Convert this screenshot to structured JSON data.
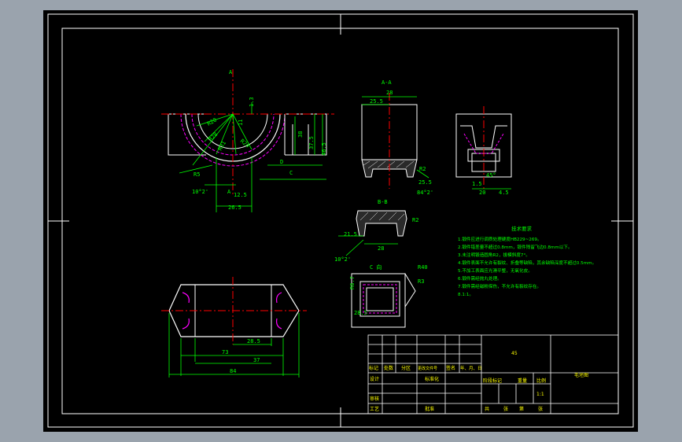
{
  "colors": {
    "window_bg": "#9aa3ad",
    "canvas_bg": "#000000",
    "outline": "#ffffff",
    "dimension": "#00ff00",
    "centerline": "#ff0000",
    "hidden": "#ff00ff",
    "note_text": "#00ff00",
    "title_text": "#ffff00",
    "cyan": "#00ffff"
  },
  "views": {
    "main": {
      "section_marker": "A",
      "dims": [
        "R5",
        "R20",
        "R28",
        "R31",
        "R24",
        "1.3",
        "11",
        "38",
        "37.5",
        "46.5",
        "D",
        "C",
        "A",
        "10°2'",
        "12.5",
        "26.5"
      ]
    },
    "section_aa": {
      "label": "A-A",
      "dims": [
        "28",
        "25.5",
        "R2",
        "25.5",
        "84°2'"
      ]
    },
    "side": {
      "dims": [
        "45°",
        "1.5",
        "20",
        "4.5"
      ]
    },
    "section_bb": {
      "label": "B-B",
      "dims": [
        "R2",
        "21.5",
        "28",
        "10°2'"
      ]
    },
    "detail_c": {
      "label": "C 向",
      "dims": [
        "R40",
        "R3",
        "R6.7",
        "28.5"
      ]
    },
    "bottom": {
      "dims": [
        "28.5",
        "73",
        "37",
        "84"
      ]
    }
  },
  "notes": {
    "title": "技术要求",
    "items": [
      "1.锻件应进行调质处理硬度HB229~269。",
      "2.锻件错差量不超过0.8mm，锻件残留飞边0.8mm以下。",
      "3.未注明锻造圆角R2，拔模斜度7°。",
      "4.锻件表面不允许有裂纹、折叠等缺陷，其余缺陷深度不超过0.5mm。",
      "5.不加工表面应光滑平整，无氧化皮。",
      "6.锻件需经抛丸处理。",
      "7.锻件需经磁粉探伤，不允许有裂纹存在。",
      "8.1:1。"
    ]
  },
  "title_block": {
    "material": "45",
    "drawing_name": "毛坯图",
    "headers": [
      "标记",
      "处数",
      "分区",
      "更改文件号",
      "签名",
      "年、月、日"
    ],
    "left_rows": [
      "设计",
      "审核",
      "工艺"
    ],
    "mid_labels": [
      "标准化",
      "批准"
    ],
    "stage_headers": [
      "阶段标记",
      "重量",
      "比例"
    ],
    "scale": "1:1",
    "sheet_info": [
      "共",
      "张",
      "第",
      "张"
    ]
  }
}
